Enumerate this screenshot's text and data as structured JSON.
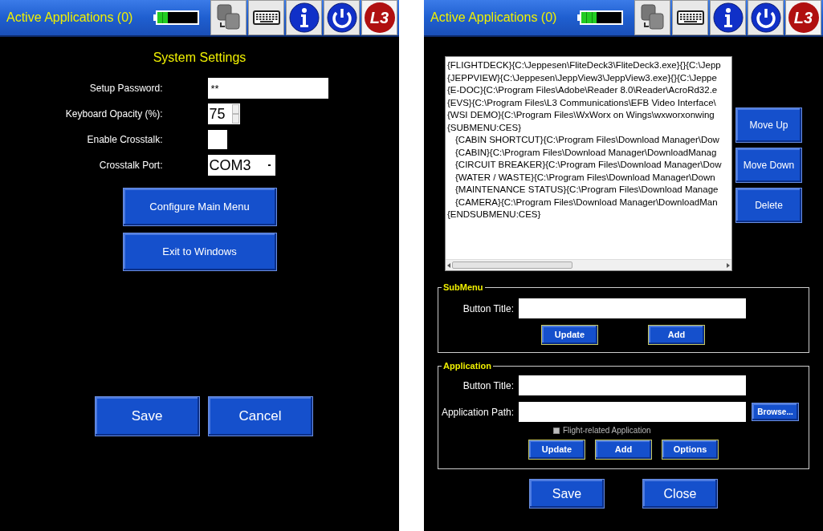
{
  "panels": [
    {
      "header": {
        "title": "Active Applications (0)",
        "battery": {
          "level": 0.25
        },
        "logo": "L3"
      },
      "settings": {
        "title": "System Settings",
        "fields": [
          {
            "kind": "text",
            "label": "Setup Password:",
            "value": "**"
          },
          {
            "kind": "spin",
            "label": "Keyboard Opacity (%):",
            "value": "75"
          },
          {
            "kind": "checkbox",
            "label": "Enable Crosstalk:",
            "checked": false
          },
          {
            "kind": "select",
            "label": "Crosstalk Port:",
            "value": "COM3"
          }
        ],
        "buttons": [
          "Configure Main Menu",
          "Exit to Windows"
        ]
      },
      "footer_buttons": [
        "Save",
        "Cancel"
      ]
    },
    {
      "header": {
        "title": "Active Applications (0)",
        "battery": {
          "level": 0.38
        },
        "logo": "L3"
      },
      "menu_list": {
        "items": [
          {
            "text": "{FLIGHTDECK}{C:\\Jeppesen\\FliteDeck3\\FliteDeck3.exe}{}{C:\\Jepp"
          },
          {
            "text": "{JEPPVIEW}{C:\\Jeppesen\\JeppView3\\JeppView3.exe}{}{C:\\Jeppe"
          },
          {
            "text": "{E-DOC}{C:\\Program Files\\Adobe\\Reader 8.0\\Reader\\AcroRd32.e"
          },
          {
            "text": "{EVS}{C:\\Program Files\\L3 Communications\\EFB Video Interface\\"
          },
          {
            "text": "{WSI DEMO}{C:\\Program Files\\WxWorx on Wings\\wxworxonwing"
          },
          {
            "text": "{SUBMENU:CES}",
            "children": [
              {
                "text": "{CABIN SHORTCUT}{C:\\Program Files\\Download Manager\\Dow"
              },
              {
                "text": "{CABIN}{C:\\Program Files\\Download Manager\\DownloadManag"
              },
              {
                "text": "{CIRCUIT BREAKER}{C:\\Program Files\\Download Manager\\Dow"
              },
              {
                "text": "{WATER / WASTE}{C:\\Program Files\\Download Manager\\Down"
              },
              {
                "text": "{MAINTENANCE STATUS}{C:\\Program Files\\Download Manage"
              },
              {
                "text": "{CAMERA}{C:\\Program Files\\Download Manager\\DownloadMan"
              }
            ]
          },
          {
            "text": "{ENDSUBMENU:CES}"
          }
        ],
        "buttons": [
          "Move Up",
          "Move Down",
          "Delete"
        ]
      },
      "submenu": {
        "legend": "SubMenu",
        "title_label": "Button Title:",
        "buttons": [
          "Update",
          "Add"
        ]
      },
      "application": {
        "legend": "Application",
        "title_label": "Button Title:",
        "path_label": "Application Path:",
        "browse": "Browse...",
        "flight_related": {
          "label": "Flight-related Application",
          "checked": false
        },
        "buttons": [
          "Update",
          "Add",
          "Options"
        ]
      },
      "footer_buttons": [
        "Save",
        "Close"
      ]
    }
  ]
}
